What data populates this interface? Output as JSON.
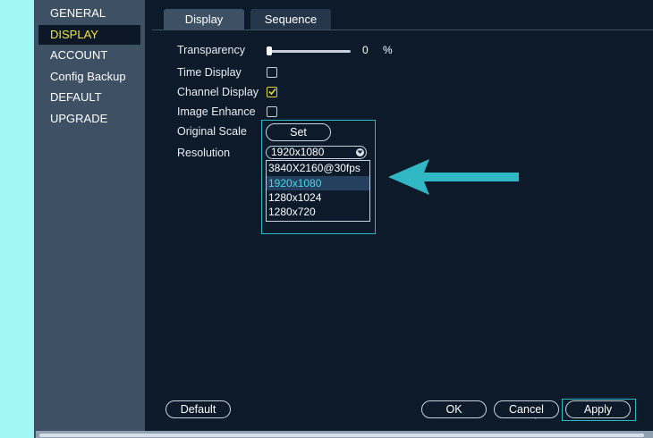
{
  "sidebar": {
    "items": [
      {
        "label": "GENERAL"
      },
      {
        "label": "DISPLAY",
        "active": true
      },
      {
        "label": "ACCOUNT"
      },
      {
        "label": "Config Backup"
      },
      {
        "label": "DEFAULT"
      },
      {
        "label": "UPGRADE"
      }
    ]
  },
  "tabs": [
    {
      "label": "Display",
      "active": true
    },
    {
      "label": "Sequence"
    }
  ],
  "settings": {
    "transparency": {
      "label": "Transparency",
      "value": "0",
      "unit": "%",
      "level": 0
    },
    "time_display": {
      "label": "Time Display",
      "checked": false
    },
    "channel_display": {
      "label": "Channel Display",
      "checked": true
    },
    "image_enhance": {
      "label": "Image Enhance",
      "checked": false
    },
    "original_scale": {
      "label": "Original Scale",
      "button_label": "Set"
    },
    "resolution": {
      "label": "Resolution",
      "selected": "1920x1080",
      "options": [
        "3840X2160@30fps",
        "1920x1080",
        "1280x1024",
        "1280x720"
      ],
      "highlighted_index": 1
    }
  },
  "footer": {
    "default_label": "Default",
    "ok_label": "OK",
    "cancel_label": "Cancel",
    "apply_label": "Apply"
  },
  "icons": {
    "check": "check-icon",
    "dropdown": "chevron-down-icon",
    "annotation_arrow": "arrow-icon"
  },
  "colors": {
    "accent_cyan": "#2fb8c4",
    "active_text": "#f2e53d",
    "panel_bg": "#0d1a2a",
    "sidebar_bg": "#3e5064"
  }
}
